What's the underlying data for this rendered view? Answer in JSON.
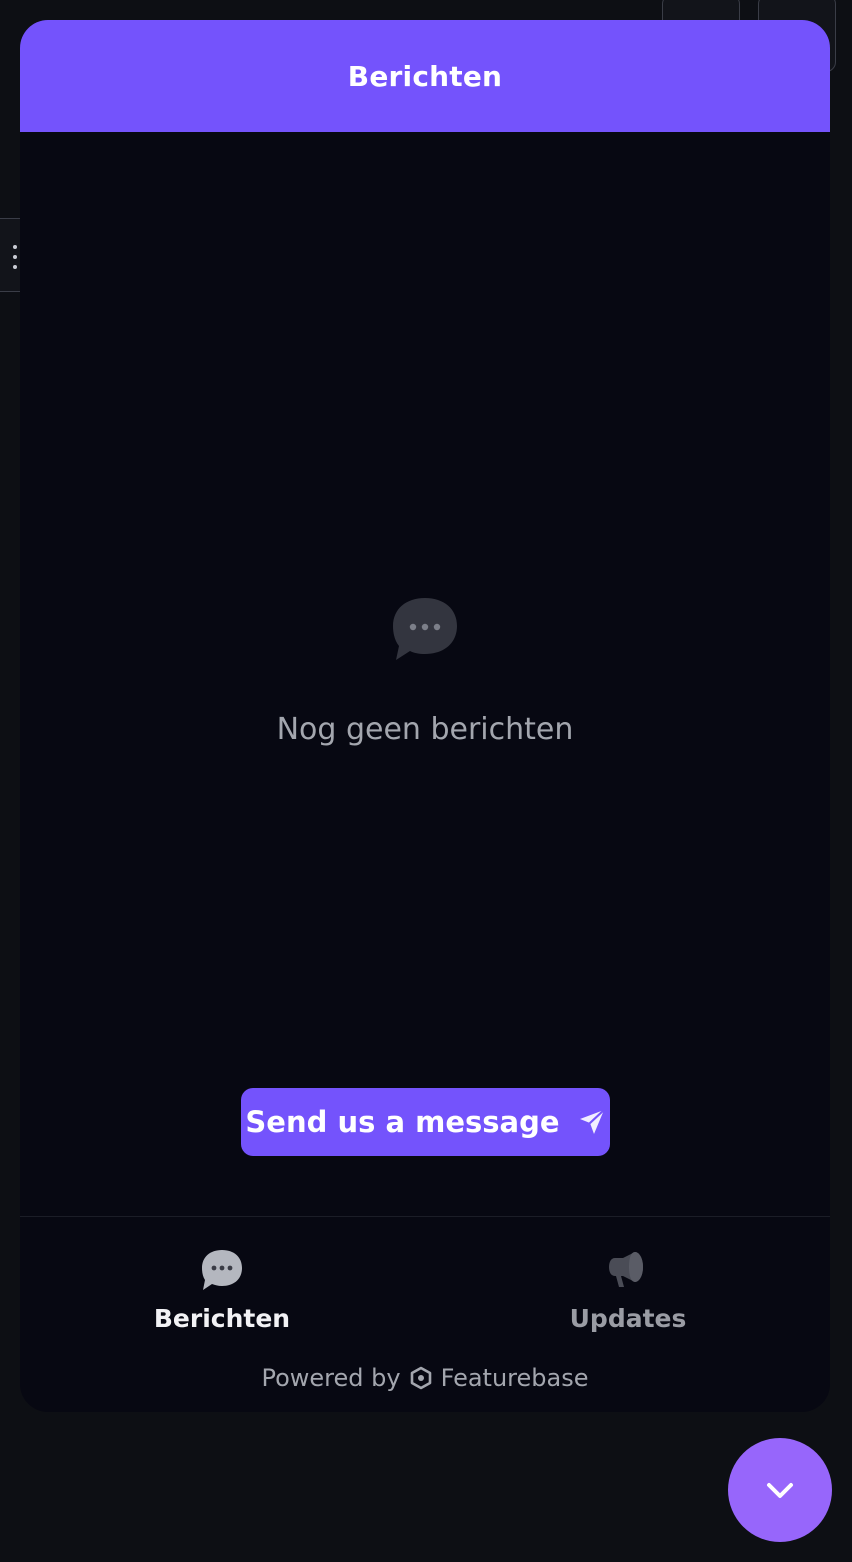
{
  "widget": {
    "header_title": "Berichten",
    "empty_state": {
      "icon": "chat-bubble-icon",
      "text": "Nog geen berichten"
    },
    "send_button": {
      "label": "Send us a message",
      "icon": "send-icon"
    },
    "tabs": [
      {
        "label": "Berichten",
        "icon": "chat-bubble-icon",
        "active": true
      },
      {
        "label": "Updates",
        "icon": "megaphone-icon",
        "active": false
      }
    ],
    "footer": {
      "prefix": "Powered by",
      "brand": "Featurebase",
      "brand_icon": "featurebase-logo-icon"
    }
  },
  "launcher": {
    "icon": "chevron-down-icon"
  },
  "colors": {
    "accent": "#7453fc",
    "launcher": "#9766fb",
    "panel_bg": "#070812",
    "page_bg": "#0d0f14"
  }
}
